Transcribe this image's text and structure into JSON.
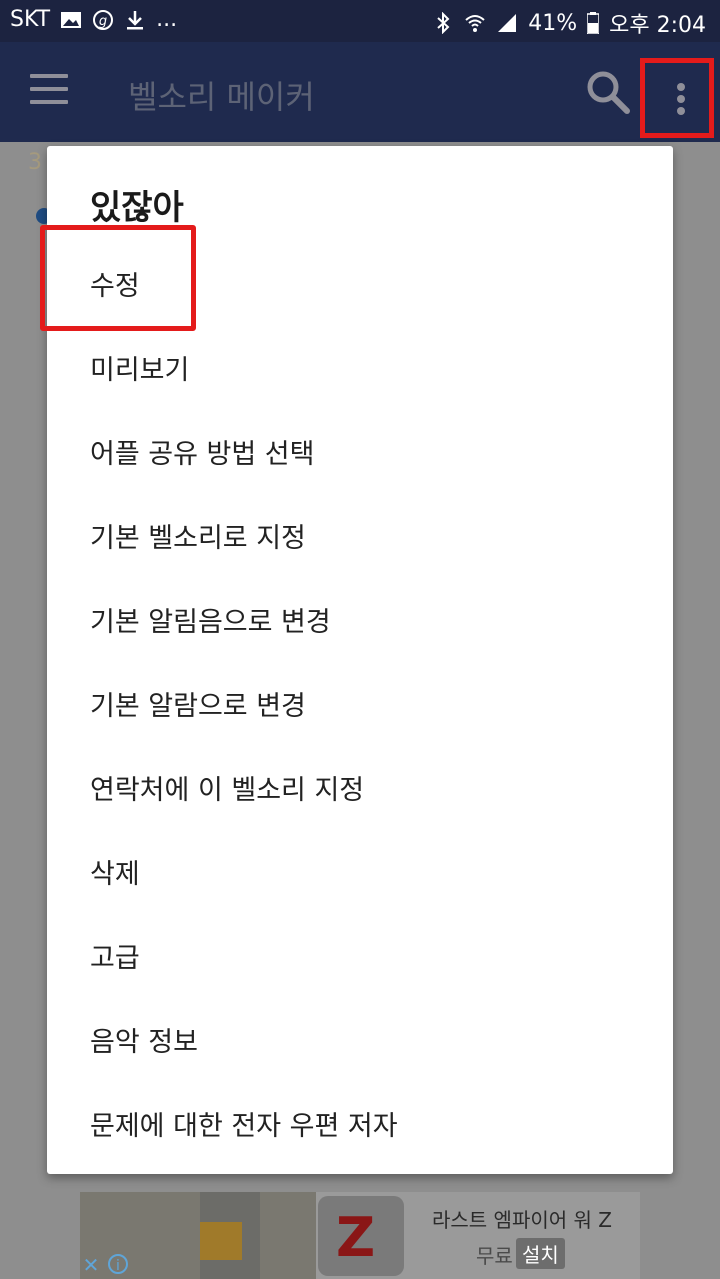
{
  "status_bar": {
    "carrier": "SKT",
    "extra": "...",
    "battery": "41%",
    "time": "오후 2:04"
  },
  "app_bar": {
    "title": "벨소리 메이커"
  },
  "background": {
    "partial_number": "3"
  },
  "menu": {
    "title": "있잖아",
    "items": [
      {
        "label": "수정"
      },
      {
        "label": "미리보기"
      },
      {
        "label": "어플 공유 방법 선택"
      },
      {
        "label": "기본 벨소리로 지정"
      },
      {
        "label": "기본 알림음으로 변경"
      },
      {
        "label": "기본 알람으로 변경"
      },
      {
        "label": "연락처에 이 벨소리 지정"
      },
      {
        "label": "삭제"
      },
      {
        "label": "고급"
      },
      {
        "label": "음악 정보"
      },
      {
        "label": "문제에 대한 전자 우편 저자"
      }
    ]
  },
  "ad": {
    "title": "라스트 엠파이어 워 Z",
    "price": "무료",
    "install": "설치",
    "icon_letter": "Z",
    "close_glyph": "✕",
    "info_glyph": "i"
  },
  "colors": {
    "app_bar": "#1f2a4e",
    "status_bar": "#1c2340",
    "highlight": "#e41b1b",
    "dim_background": "#8e8e8e"
  }
}
